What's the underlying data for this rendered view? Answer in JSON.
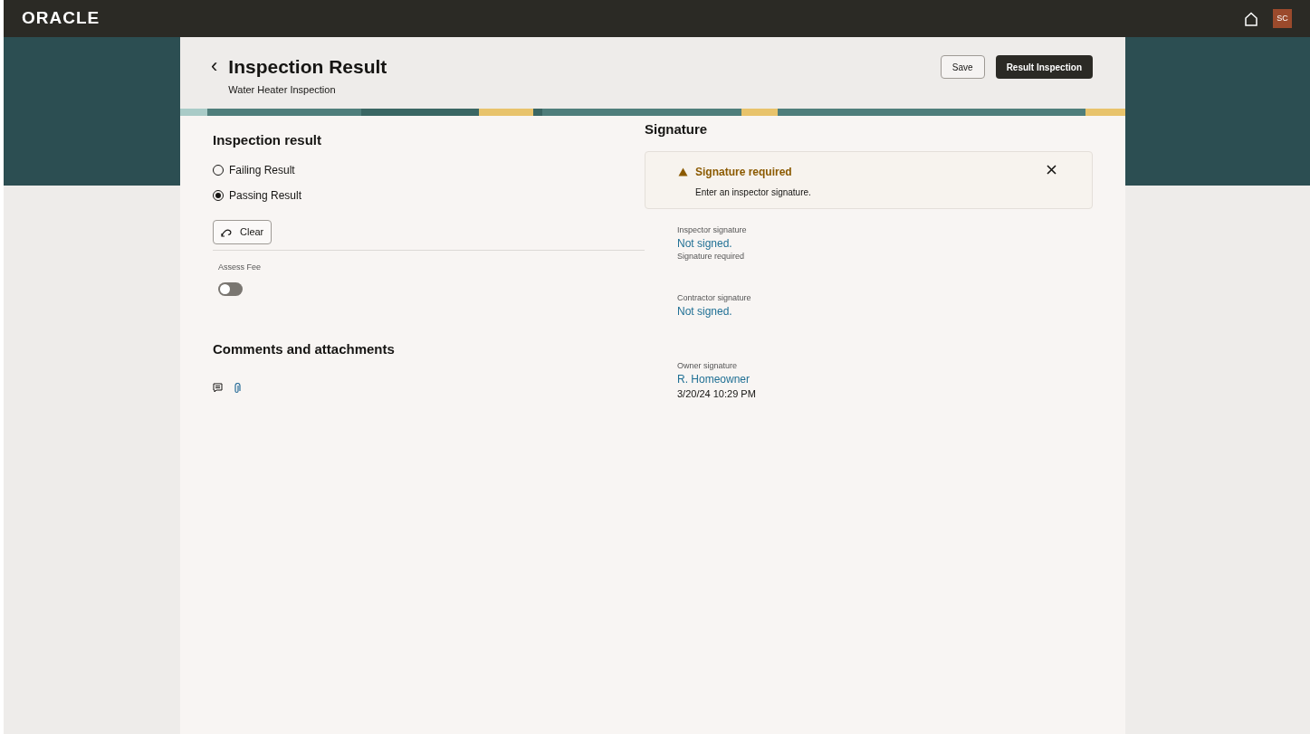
{
  "top_bar": {
    "logo": "ORACLE",
    "avatar": "SC"
  },
  "header": {
    "back": "‹",
    "title": "Inspection Result",
    "subtitle": "Water Heater Inspection",
    "buttons": [
      {
        "label": "Save",
        "kind": "secondary"
      },
      {
        "label": "Result Inspection",
        "kind": "primary"
      }
    ]
  },
  "inspection_result": {
    "heading": "Inspection result",
    "options": [
      {
        "label": "Failing Result",
        "selected": false
      },
      {
        "label": "Passing Result",
        "selected": true
      }
    ],
    "clear_button": "Clear",
    "assess_fee": {
      "label": "Assess Fee",
      "on": false
    }
  },
  "comments": {
    "heading": "Comments and attachments"
  },
  "signature": {
    "heading": "Signature",
    "alert": {
      "title": "Signature required",
      "message": "Enter an inspector signature."
    },
    "items": [
      {
        "label": "Inspector signature",
        "value": "Not signed.",
        "note": "Signature required"
      },
      {
        "label": "Contractor signature",
        "value": "Not signed."
      },
      {
        "label": "Owner signature",
        "value": "R. Homeowner",
        "date": "3/20/24 10:29 PM"
      }
    ]
  }
}
